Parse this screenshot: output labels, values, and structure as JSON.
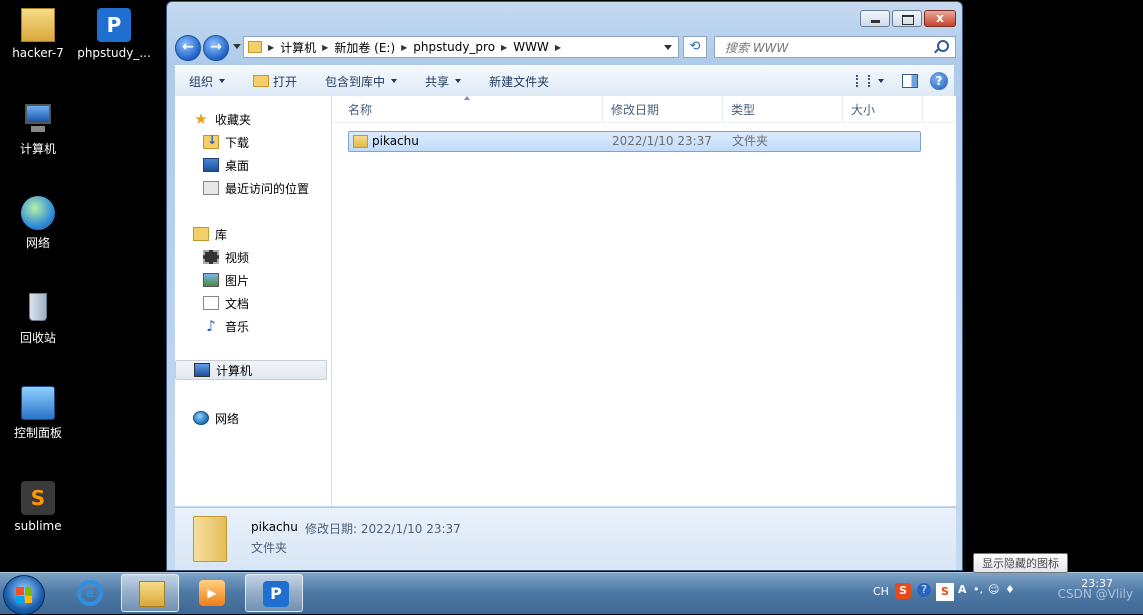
{
  "desktop": {
    "icons": [
      {
        "label": "hacker-7"
      },
      {
        "label": "phpstudy_..."
      },
      {
        "label": "计算机"
      },
      {
        "label": "网络"
      },
      {
        "label": "回收站"
      },
      {
        "label": "控制面板"
      },
      {
        "label": "sublime"
      }
    ]
  },
  "window": {
    "caption": {
      "minimize": "",
      "maximize": "",
      "close": "x"
    },
    "address": {
      "segments": [
        "计算机",
        "新加卷 (E:)",
        "phpstudy_pro",
        "WWW"
      ]
    },
    "search": {
      "placeholder": "搜索 WWW"
    },
    "toolbar": {
      "organize": "组织",
      "open": "打开",
      "include_library": "包含到库中",
      "share": "共享",
      "new_folder": "新建文件夹"
    },
    "nav_pane": {
      "favorites": "收藏夹",
      "downloads": "下载",
      "desktop": "桌面",
      "recent": "最近访问的位置",
      "libraries": "库",
      "videos": "视频",
      "pictures": "图片",
      "documents": "文档",
      "music": "音乐",
      "computer": "计算机",
      "network": "网络"
    },
    "columns": {
      "name": "名称",
      "modified": "修改日期",
      "type": "类型",
      "size": "大小"
    },
    "files": [
      {
        "name": "pikachu",
        "modified": "2022/1/10 23:37",
        "type": "文件夹",
        "size": ""
      }
    ],
    "details": {
      "name": "pikachu",
      "modified": "修改日期: 2022/1/10 23:37",
      "type": "文件夹"
    }
  },
  "taskbar": {
    "tray": {
      "lang": "CH",
      "tooltip": "显示隐藏的图标",
      "clock": "23:37",
      "watermark": "CSDN @Vlily"
    }
  },
  "colors": {
    "taskbar": "#4f7aa6",
    "selection": "#c1dcfc",
    "folder": "#f2cf6a"
  }
}
